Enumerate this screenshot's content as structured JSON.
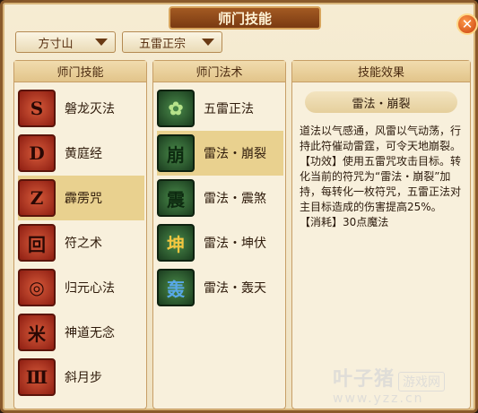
{
  "title": "师门技能",
  "close_symbol": "✕",
  "dropdowns": {
    "school": "方寸山",
    "skill_set": "五雷正宗"
  },
  "panels": {
    "skills_header": "师门技能",
    "spells_header": "师门法术",
    "effect_header": "技能效果"
  },
  "skills": [
    {
      "label": "磐龙灭法",
      "glyph": "S"
    },
    {
      "label": "黄庭经",
      "glyph": "D"
    },
    {
      "label": "霹雳咒",
      "glyph": "Z"
    },
    {
      "label": "符之术",
      "glyph": "回"
    },
    {
      "label": "归元心法",
      "glyph": "◎"
    },
    {
      "label": "神道无念",
      "glyph": "米"
    },
    {
      "label": "斜月步",
      "glyph": "Ⅲ"
    }
  ],
  "spells": [
    {
      "label": "五雷正法",
      "glyph": "✿"
    },
    {
      "label": "雷法・崩裂",
      "glyph": "崩"
    },
    {
      "label": "雷法・震煞",
      "glyph": "震"
    },
    {
      "label": "雷法・坤伏",
      "glyph": "坤"
    },
    {
      "label": "雷法・轰天",
      "glyph": "轰"
    }
  ],
  "effect": {
    "name": "雷法・崩裂",
    "description": "道法以气感通，风雷以气动荡，行持此符催动雷霆，可令天地崩裂。",
    "function": "【功效】使用五雷咒攻击目标。转化当前的符咒为“雷法・崩裂”加持，每转化一枚符咒，五雷正法对主目标造成的伤害提高25%。",
    "cost": "【消耗】30点魔法"
  },
  "watermark": {
    "name": "叶子猪",
    "tag": "游戏网",
    "url": "www.yzz.cn"
  }
}
